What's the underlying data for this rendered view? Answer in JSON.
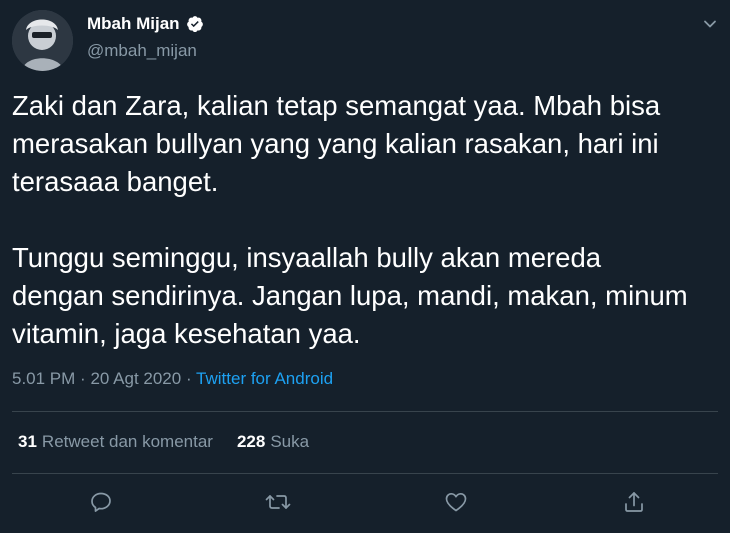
{
  "colors": {
    "background": "#15202b",
    "text": "#ffffff",
    "secondary_text": "#8899a6",
    "link": "#1da1f2",
    "divider": "#38444d"
  },
  "author": {
    "display_name": "Mbah Mijan",
    "handle": "@mbah_mijan",
    "verified_icon": "verified-badge-icon",
    "avatar_icon": "profile-avatar"
  },
  "tweet": {
    "text": "Zaki dan Zara, kalian tetap semangat yaa. Mbah bisa\nmerasakan bullyan yang yang kalian rasakan, hari ini\nterasaaa banget.\n\nTunggu seminggu, insyaallah bully akan mereda\ndengan sendirinya. Jangan lupa, mandi, makan, minum\nvitamin, jaga kesehatan yaa."
  },
  "meta": {
    "time": "5.01 PM",
    "separator": "·",
    "date": "20 Agt 2020",
    "source": "Twitter for Android"
  },
  "stats": {
    "retweets_count": "31",
    "retweets_label": "Retweet dan komentar",
    "likes_count": "228",
    "likes_label": "Suka"
  },
  "actions": {
    "reply_icon": "reply-icon",
    "retweet_icon": "retweet-icon",
    "like_icon": "heart-icon",
    "share_icon": "share-icon",
    "more_icon": "chevron-down-icon"
  }
}
